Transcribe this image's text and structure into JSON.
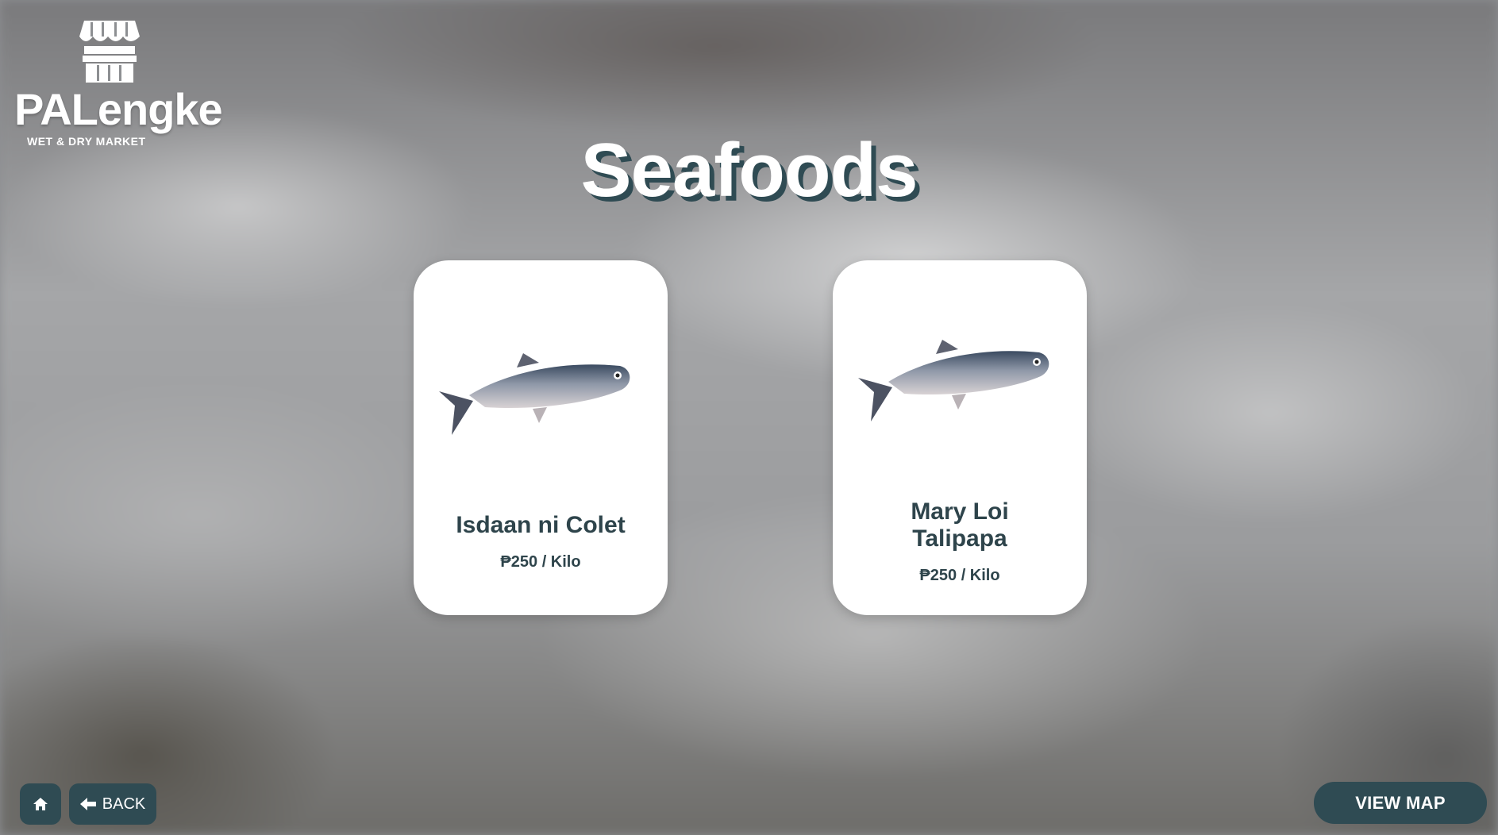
{
  "brand": {
    "name": "PALengke",
    "tagline": "WET & DRY MARKET"
  },
  "page": {
    "title": "Seafoods"
  },
  "vendors": [
    {
      "name": "Isdaan ni Colet",
      "price": "₱250 / Kilo",
      "image": "milkfish"
    },
    {
      "name": "Mary Loi Talipapa",
      "price": "₱250 / Kilo",
      "image": "milkfish"
    }
  ],
  "nav": {
    "home_icon": "home-icon",
    "back_label": "BACK",
    "back_icon": "arrow-left-icon",
    "map_label": "VIEW MAP"
  },
  "colors": {
    "accent": "#2f4b53",
    "card": "#ffffff",
    "text_dark": "#2e444b"
  }
}
